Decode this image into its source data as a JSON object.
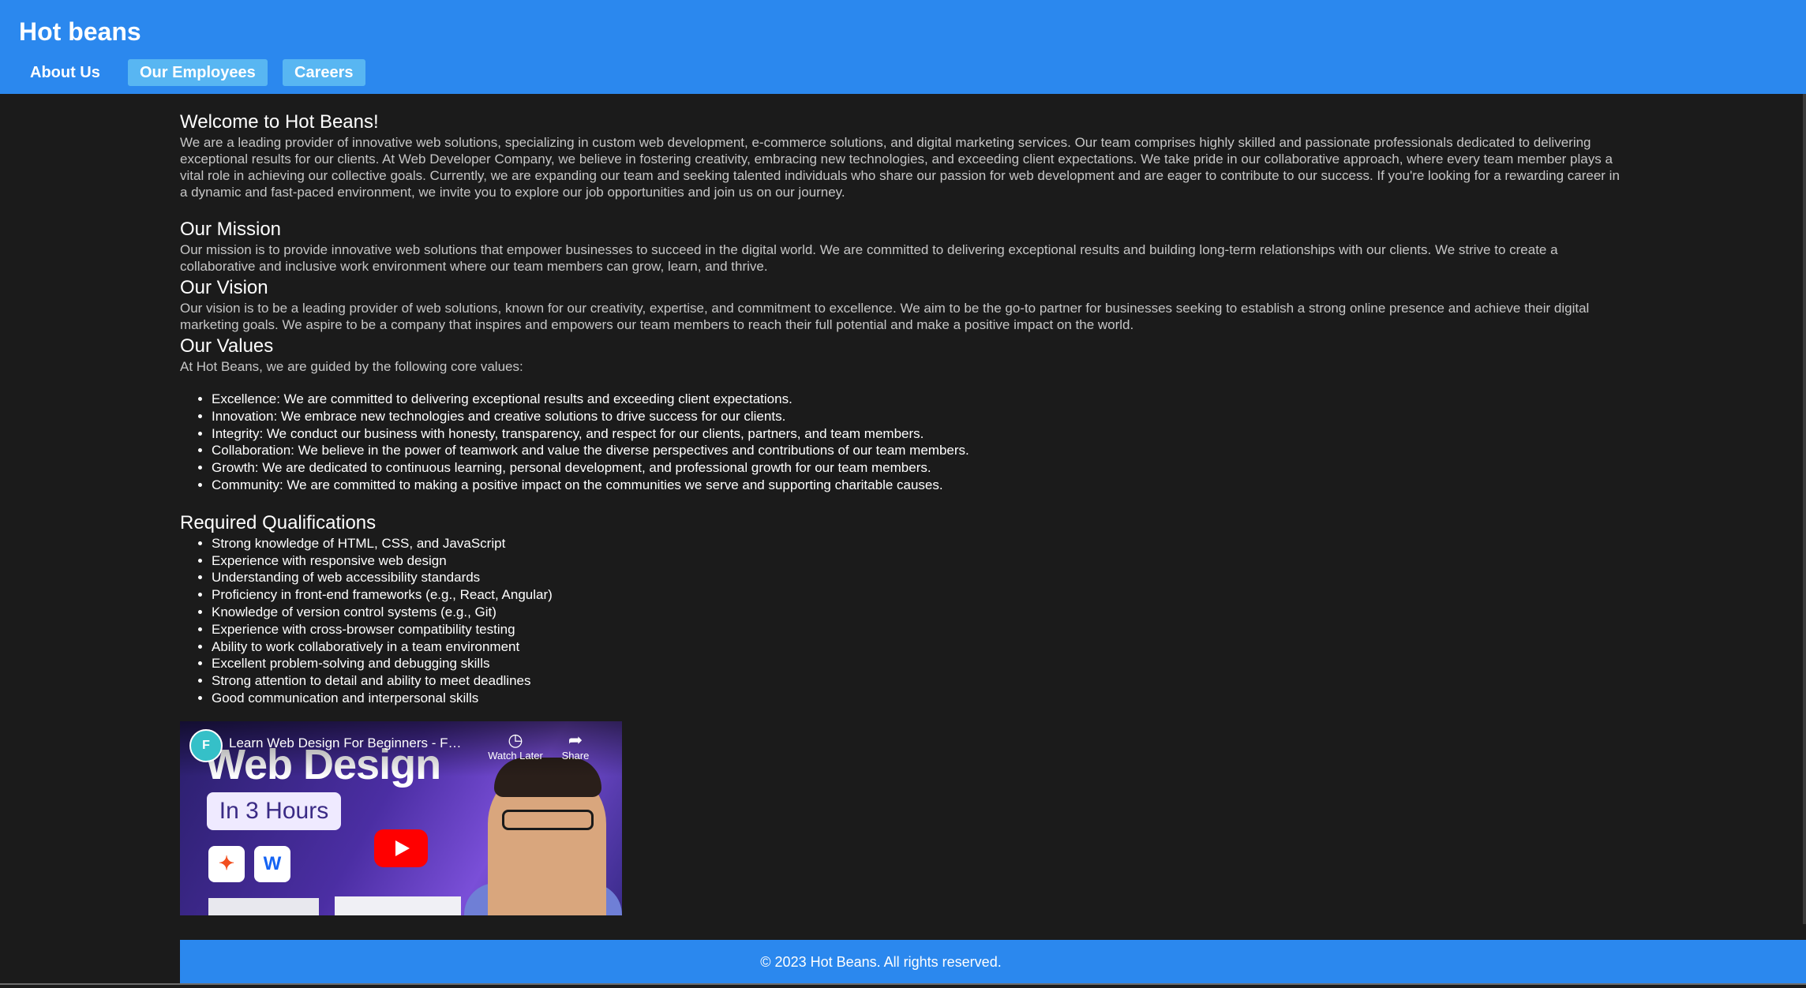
{
  "header": {
    "site_title": "Hot beans",
    "nav": [
      {
        "label": "About Us",
        "style": "plain"
      },
      {
        "label": "Our Employees",
        "style": "pill"
      },
      {
        "label": "Careers",
        "style": "pill"
      }
    ]
  },
  "welcome": {
    "title": "Welcome to Hot Beans!",
    "body": "We are a leading provider of innovative web solutions, specializing in custom web development, e-commerce solutions, and digital marketing services. Our team comprises highly skilled and passionate professionals dedicated to delivering exceptional results for our clients. At Web Developer Company, we believe in fostering creativity, embracing new technologies, and exceeding client expectations. We take pride in our collaborative approach, where every team member plays a vital role in achieving our collective goals. Currently, we are expanding our team and seeking talented individuals who share our passion for web development and are eager to contribute to our success. If you're looking for a rewarding career in a dynamic and fast-paced environment, we invite you to explore our job opportunities and join us on our journey."
  },
  "mission": {
    "title": "Our Mission",
    "body": "Our mission is to provide innovative web solutions that empower businesses to succeed in the digital world. We are committed to delivering exceptional results and building long-term relationships with our clients. We strive to create a collaborative and inclusive work environment where our team members can grow, learn, and thrive."
  },
  "vision": {
    "title": "Our Vision",
    "body": "Our vision is to be a leading provider of web solutions, known for our creativity, expertise, and commitment to excellence. We aim to be the go-to partner for businesses seeking to establish a strong online presence and achieve their digital marketing goals. We aspire to be a company that inspires and empowers our team members to reach their full potential and make a positive impact on the world."
  },
  "values": {
    "title": "Our Values",
    "intro": "At Hot Beans, we are guided by the following core values:",
    "items": [
      "Excellence: We are committed to delivering exceptional results and exceeding client expectations.",
      "Innovation: We embrace new technologies and creative solutions to drive success for our clients.",
      "Integrity: We conduct our business with honesty, transparency, and respect for our clients, partners, and team members.",
      "Collaboration: We believe in the power of teamwork and value the diverse perspectives and contributions of our team members.",
      "Growth: We are dedicated to continuous learning, personal development, and professional growth for our team members.",
      "Community: We are committed to making a positive impact on the communities we serve and supporting charitable causes."
    ]
  },
  "qualifications": {
    "title": "Required Qualifications",
    "items": [
      "Strong knowledge of HTML, CSS, and JavaScript",
      "Experience with responsive web design",
      "Understanding of web accessibility standards",
      "Proficiency in front-end frameworks (e.g., React, Angular)",
      "Knowledge of version control systems (e.g., Git)",
      "Experience with cross-browser compatibility testing",
      "Ability to work collaboratively in a team environment",
      "Excellent problem-solving and debugging skills",
      "Strong attention to detail and ability to meet deadlines",
      "Good communication and interpersonal skills"
    ]
  },
  "video": {
    "title": "Learn Web Design For Beginners - Full ...",
    "thumb_heading": "Web Design",
    "thumb_badge": "In 3 Hours",
    "channel_icon": "flux-logo",
    "watch_later_label": "Watch Later",
    "share_label": "Share"
  },
  "footer": {
    "text": "© 2023 Hot Beans. All rights reserved."
  },
  "colors": {
    "header_bg": "#2b88ee",
    "nav_pill_bg": "#58b6f2",
    "page_bg": "#1b1b1b",
    "footer_bg": "#2b88ee"
  }
}
